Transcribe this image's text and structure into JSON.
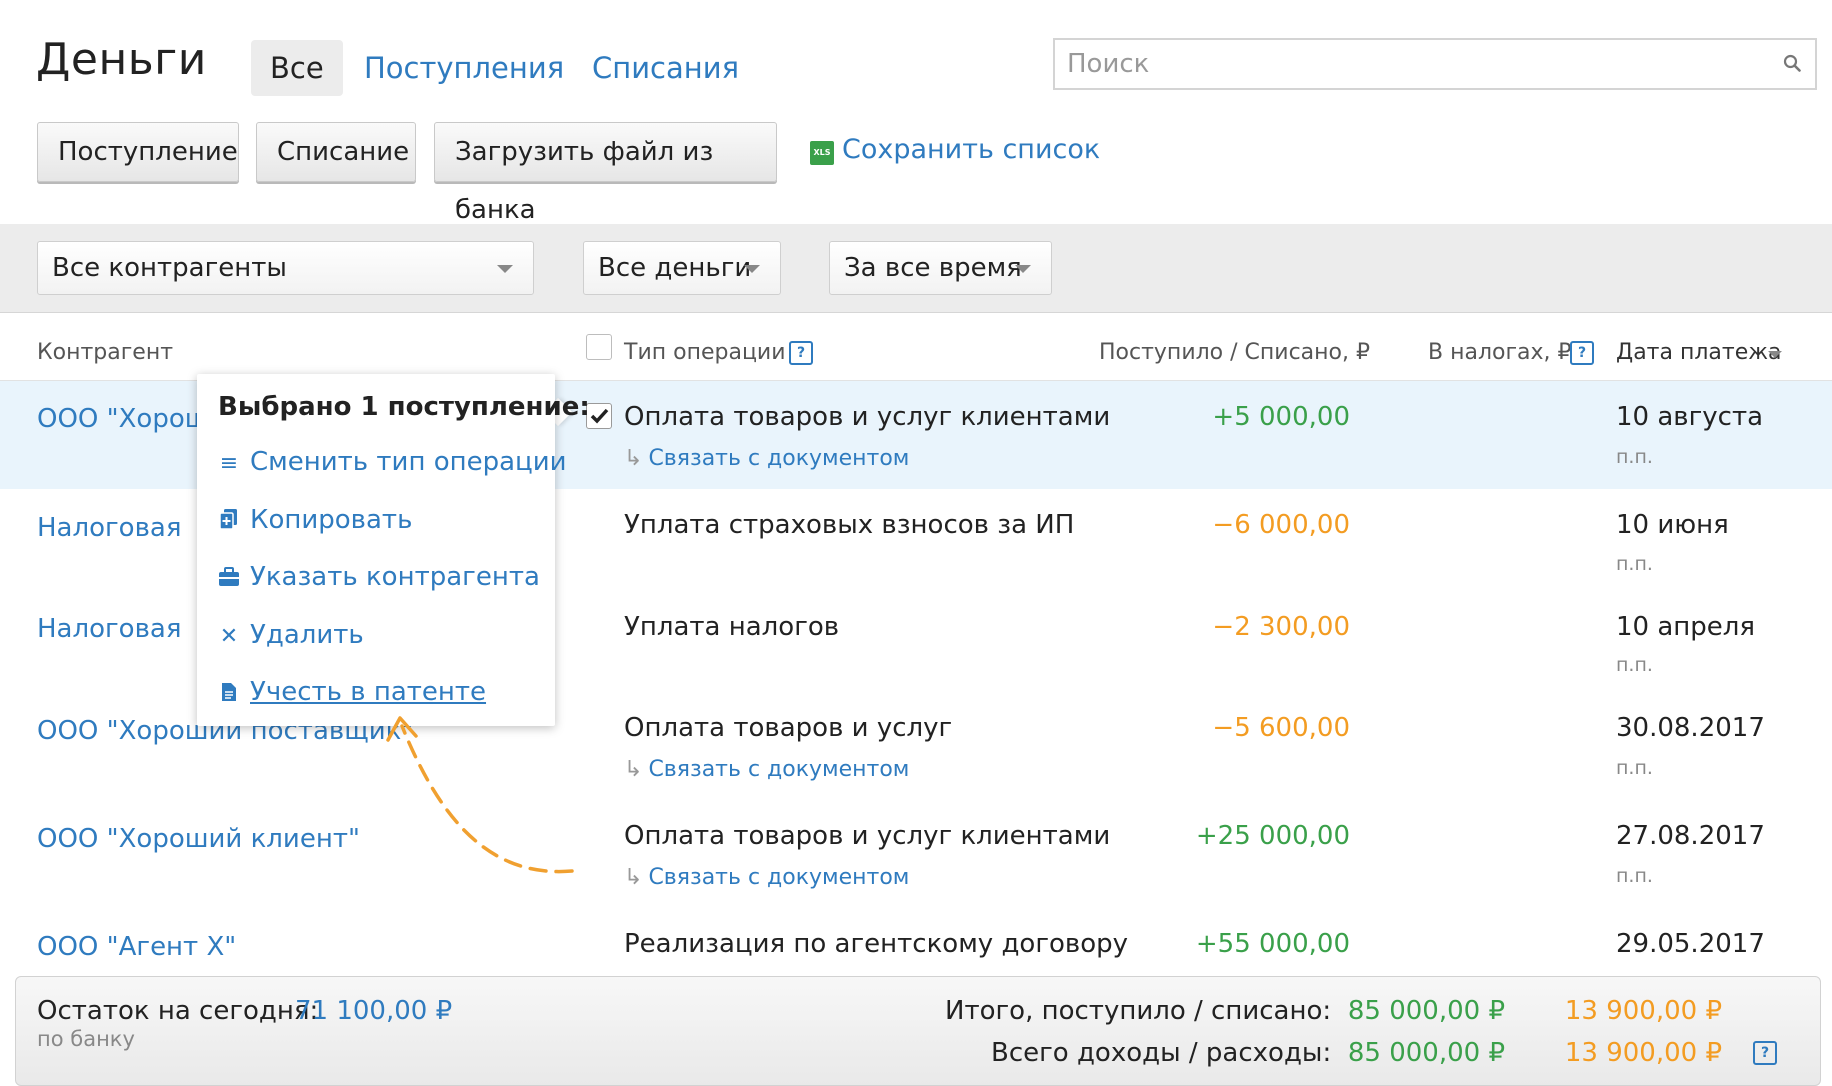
{
  "header": {
    "title": "Деньги",
    "tabs": [
      "Все",
      "Поступления",
      "Списания"
    ],
    "search_placeholder": "Поиск"
  },
  "toolbar": {
    "income_btn": "Поступление",
    "expense_btn": "Списание",
    "upload_btn": "Загрузить файл из банка",
    "save_link": "Сохранить список",
    "xls_icon_text": "XLS"
  },
  "filters": {
    "partner": "Все контрагенты",
    "money": "Все деньги",
    "period": "За все время"
  },
  "table": {
    "headers": {
      "partner": "Контрагент",
      "type": "Тип операции",
      "amount": "Поступило / Списано, ₽",
      "taxes": "В налогах, ₽",
      "date": "Дата платежа"
    },
    "rows": [
      {
        "partner": "ООО \"Хороший клиент\"",
        "type": "Оплата товаров и услуг клиентами",
        "link": "Связать с документом",
        "amount": "+5 000,00",
        "date": "10 августа",
        "pp": "п.п.",
        "checked": true
      },
      {
        "partner": "Налоговая",
        "type": "Уплата страховых взносов за ИП",
        "link": "",
        "amount": "−6 000,00",
        "date": "10 июня",
        "pp": "п.п."
      },
      {
        "partner": "Налоговая",
        "type": "Уплата налогов",
        "link": "",
        "amount": "−2 300,00",
        "date": "10 апреля",
        "pp": "п.п."
      },
      {
        "partner": "ООО \"Хороший поставщик\"",
        "type": "Оплата товаров и услуг",
        "link": "Связать с документом",
        "amount": "−5 600,00",
        "date": "30.08.2017",
        "pp": "п.п."
      },
      {
        "partner": "ООО \"Хороший клиент\"",
        "type": "Оплата товаров и услуг клиентами",
        "link": "Связать с документом",
        "amount": "+25 000,00",
        "date": "27.08.2017",
        "pp": "п.п."
      },
      {
        "partner": "ООО \"Агент Х\"",
        "type": "Реализация по агентскому договору",
        "link": "",
        "amount": "+55 000,00",
        "date": "29.05.2017",
        "pp": ""
      }
    ]
  },
  "popup": {
    "title": "Выбрано 1 поступление:",
    "items": [
      "Сменить тип операции",
      "Копировать",
      "Указать контрагента",
      "Удалить",
      "Учесть в патенте"
    ]
  },
  "footer": {
    "balance_label": "Остаток на сегодня:",
    "balance_value": "71 100,00 ₽",
    "balance_sub": "по банку",
    "total_label": "Итого, поступило / списано:",
    "total_in": "85 000,00 ₽",
    "total_out": "13 900,00 ₽",
    "all_label": "Всего доходы / расходы:",
    "all_in": "85 000,00 ₽",
    "all_out": "13 900,00 ₽"
  },
  "colors": {
    "link": "#2f7bbf",
    "income": "#3aa04a",
    "expense": "#f39c22",
    "annotation_arrow": "#f0a030",
    "selected_row": "#e9f4fc"
  }
}
